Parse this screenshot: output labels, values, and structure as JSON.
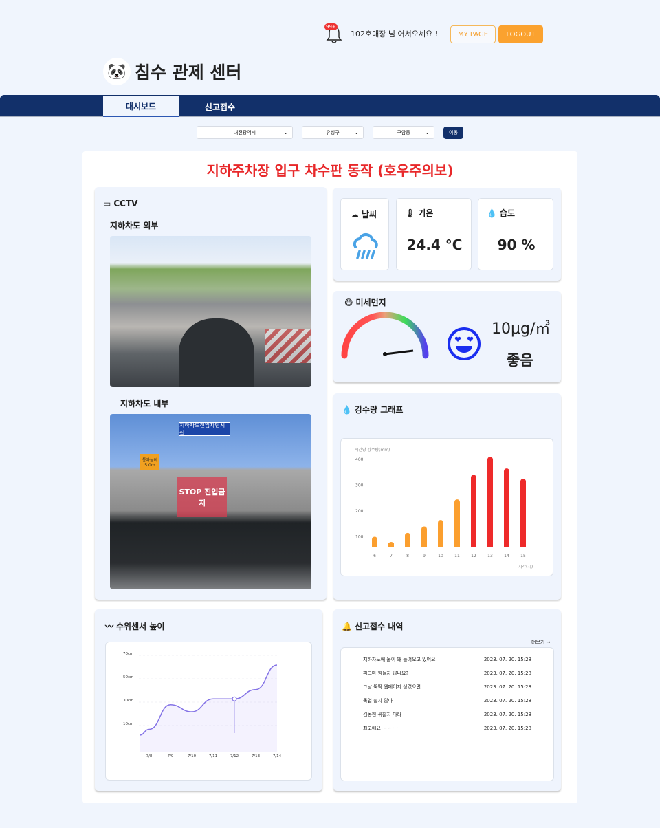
{
  "header": {
    "notification_count": "99+",
    "welcome": "102호대장  님 어서오세요 !",
    "my_page": "MY PAGE",
    "logout": "LOGOUT",
    "title": "침수 관제 센터"
  },
  "nav": {
    "tabs": [
      "대시보드",
      "신고접수"
    ],
    "active": 0
  },
  "location": {
    "city": "대전광역시",
    "district": "유성구",
    "dong": "구암동",
    "go": "이동"
  },
  "alert": "지하주차장 입구 차수판 동작 (호우주의보)",
  "cctv": {
    "title": "CCTV",
    "outside_label": "지하차도 외부",
    "inside_label": "지하차도 내부",
    "inside_sign": "지하차도진입차단시설",
    "inside_stop": "STOP 진입금지",
    "inside_height": "통과높이 5.0m"
  },
  "weather": {
    "title": "날씨",
    "icon": "rain-cloud-icon",
    "temp_title": "기온",
    "temp": "24.4 °C",
    "humid_title": "습도",
    "humid": "90 %"
  },
  "dust": {
    "title": "미세먼지",
    "value": "10μg/㎥",
    "status": "좋음",
    "level": 0.05,
    "face": "heart-eyes-icon"
  },
  "rain_chart": {
    "title": "강수량 그래프"
  },
  "water": {
    "title": "수위센서 높이"
  },
  "reports": {
    "title": "신고접수 내역",
    "more": "더보기 →",
    "items": [
      {
        "text": "지하차도에 물이 꽤 들어오고 있어요",
        "date": "2023. 07. 20. 15:28"
      },
      {
        "text": "피그마 힘들지 않나요?",
        "date": "2023. 07. 20. 15:28"
      },
      {
        "text": "그냥 뚝딱 웹페이지 생겼으면",
        "date": "2023. 07. 20. 15:28"
      },
      {
        "text": "목업 쉽지 않다",
        "date": "2023. 07. 20. 15:28"
      },
      {
        "text": "김동현 귀찮지 마라",
        "date": "2023. 07. 20. 15:28"
      },
      {
        "text": "최고에요 ~~~~",
        "date": "2023. 07. 20. 15:28"
      }
    ]
  },
  "chart_data": [
    {
      "type": "bar",
      "ylabel": "시간당 강수량(mm)",
      "xlabel": "시각(시)",
      "categories": [
        "6",
        "7",
        "8",
        "9",
        "10",
        "11",
        "12",
        "13",
        "14",
        "15"
      ],
      "values": [
        100,
        80,
        115,
        140,
        165,
        245,
        340,
        410,
        365,
        325
      ],
      "yticks": [
        "100",
        "200",
        "300",
        "400"
      ],
      "colors": {
        "normal": "#fb9f2f",
        "warning": "#ee2a2a"
      }
    },
    {
      "type": "area",
      "categories": [
        "7/8",
        "7/9",
        "7/10",
        "7/11",
        "7/12",
        "7/13",
        "7/14"
      ],
      "values": [
        5,
        26,
        20,
        31,
        31,
        39,
        60
      ],
      "yticks": [
        "10cm",
        "30cm",
        "50cm",
        "70cm"
      ],
      "unit": "cm",
      "highlight": "7/12",
      "color": "#8473e6"
    }
  ]
}
